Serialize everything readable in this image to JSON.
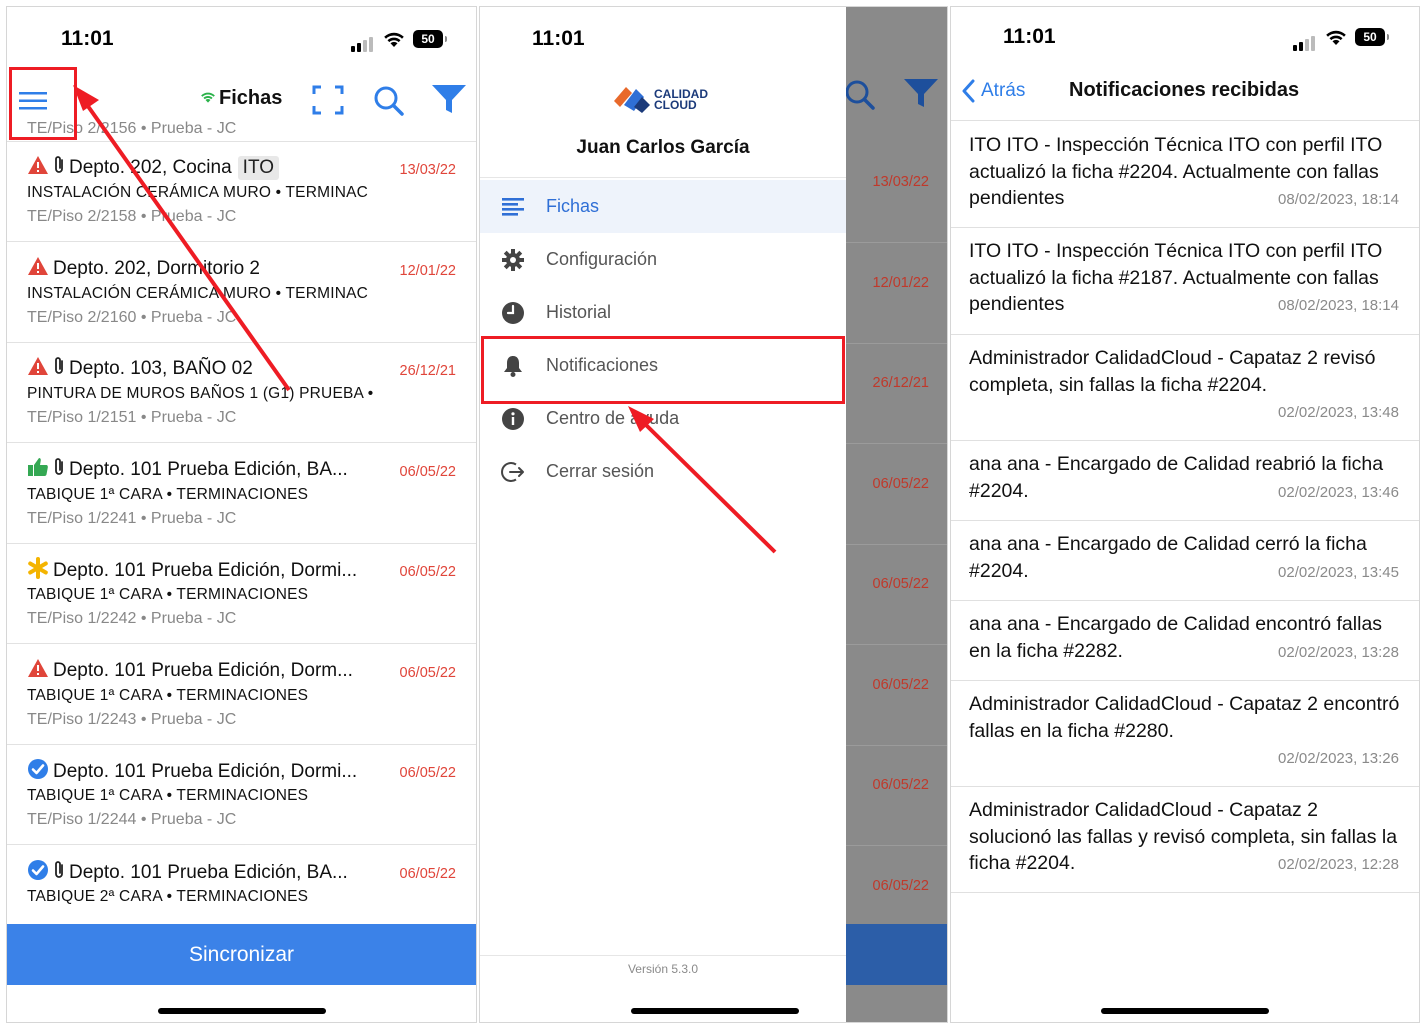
{
  "status_bar": {
    "time": "11:01",
    "battery": "50"
  },
  "panel1": {
    "title": "Fichas",
    "header_sub": "TE/Piso 2/2156 • Prueba - JC",
    "items": [
      {
        "title": "Depto. 202, Cocina",
        "tag": "ITO",
        "line2": "INSTALACIÓN CERÁMICA MURO • TERMINAC",
        "line3": "TE/Piso 2/2158 • Prueba - JC",
        "date": "13/03/22",
        "status": "warning-icon",
        "clip": true
      },
      {
        "title": "Depto. 202, Dormitorio 2",
        "tag": "",
        "line2": "INSTALACIÓN CERÁMICA MURO • TERMINAC",
        "line3": "TE/Piso 2/2160 • Prueba - JC",
        "date": "12/01/22",
        "status": "warning-icon",
        "clip": false
      },
      {
        "title": "Depto. 103, BAÑO 02",
        "tag": "",
        "line2": "PINTURA DE MUROS BAÑOS 1 (G1) PRUEBA •",
        "line3": "TE/Piso 1/2151 • Prueba - JC",
        "date": "26/12/21",
        "status": "warning-icon",
        "clip": true
      },
      {
        "title": "Depto. 101 Prueba Edición, BA...",
        "tag": "",
        "line2": "TABIQUE 1ª CARA • TERMINACIONES",
        "line3": "TE/Piso 1/2241 • Prueba - JC",
        "date": "06/05/22",
        "status": "thumbs-up-icon",
        "clip": true
      },
      {
        "title": "Depto. 101 Prueba Edición, Dormi...",
        "tag": "",
        "line2": "TABIQUE 1ª CARA • TERMINACIONES",
        "line3": "TE/Piso 1/2242 • Prueba - JC",
        "date": "06/05/22",
        "status": "asterisk-icon",
        "clip": false
      },
      {
        "title": "Depto. 101 Prueba Edición, Dorm...",
        "tag": "",
        "line2": "TABIQUE 1ª CARA • TERMINACIONES",
        "line3": "TE/Piso 1/2243 • Prueba - JC",
        "date": "06/05/22",
        "status": "warning-icon",
        "clip": false
      },
      {
        "title": "Depto. 101 Prueba Edición, Dormi...",
        "tag": "",
        "line2": "TABIQUE 1ª CARA • TERMINACIONES",
        "line3": "TE/Piso 1/2244 • Prueba - JC",
        "date": "06/05/22",
        "status": "check-circle-icon",
        "clip": false
      },
      {
        "title": "Depto. 101 Prueba Edición, BA...",
        "tag": "",
        "line2": "TABIQUE 2ª CARA • TERMINACIONES",
        "line3": "",
        "date": "06/05/22",
        "status": "check-circle-icon",
        "clip": true
      }
    ],
    "sync_label": "Sincronizar"
  },
  "panel2": {
    "logo_line1": "CALIDAD",
    "logo_line2": "CLOUD",
    "user_name": "Juan Carlos García",
    "menu": [
      {
        "label": "Fichas",
        "icon": "list-icon",
        "active": true
      },
      {
        "label": "Configuración",
        "icon": "gear-icon",
        "active": false
      },
      {
        "label": "Historial",
        "icon": "clock-icon",
        "active": false
      },
      {
        "label": "Notificaciones",
        "icon": "bell-icon",
        "active": false
      },
      {
        "label": "Centro de ayuda",
        "icon": "info-icon",
        "active": false
      },
      {
        "label": "Cerrar sesión",
        "icon": "logout-icon",
        "active": false
      }
    ],
    "overlay_dates": [
      "13/03/22",
      "12/01/22",
      "26/12/21",
      "06/05/22",
      "06/05/22",
      "06/05/22",
      "06/05/22",
      "06/05/22"
    ],
    "version": "Versión 5.3.0"
  },
  "panel3": {
    "back_label": "Atrás",
    "title": "Notificaciones recibidas",
    "notifications": [
      {
        "text": "ITO ITO - Inspección Técnica ITO con perfil ITO actualizó la ficha #2204. Actualmente con fallas pendientes",
        "date": "08/02/2023, 18:14"
      },
      {
        "text": "ITO ITO - Inspección Técnica ITO con perfil ITO actualizó la ficha #2187. Actualmente con fallas pendientes",
        "date": "08/02/2023, 18:14"
      },
      {
        "text": "Administrador CalidadCloud - Capataz 2 revisó completa, sin fallas la ficha #2204.",
        "date": "02/02/2023, 13:48"
      },
      {
        "text": "ana ana - Encargado de Calidad reabrió la ficha #2204.",
        "date": "02/02/2023, 13:46"
      },
      {
        "text": "ana ana - Encargado de Calidad cerró la ficha #2204.",
        "date": "02/02/2023, 13:45"
      },
      {
        "text": "ana ana - Encargado de Calidad encontró fallas en la ficha #2282.",
        "date": "02/02/2023, 13:28"
      },
      {
        "text": "Administrador CalidadCloud - Capataz 2 encontró fallas en la ficha #2280.",
        "date": "02/02/2023, 13:26"
      },
      {
        "text": "Administrador CalidadCloud - Capataz 2 solucionó las fallas y revisó completa, sin fallas la ficha #2204.",
        "date": "02/02/2023, 12:28"
      }
    ]
  },
  "colors": {
    "accent": "#2f7ee8",
    "date_red": "#e0453a",
    "sync_bar": "#3b82e8",
    "annotation": "#ee1c24"
  }
}
